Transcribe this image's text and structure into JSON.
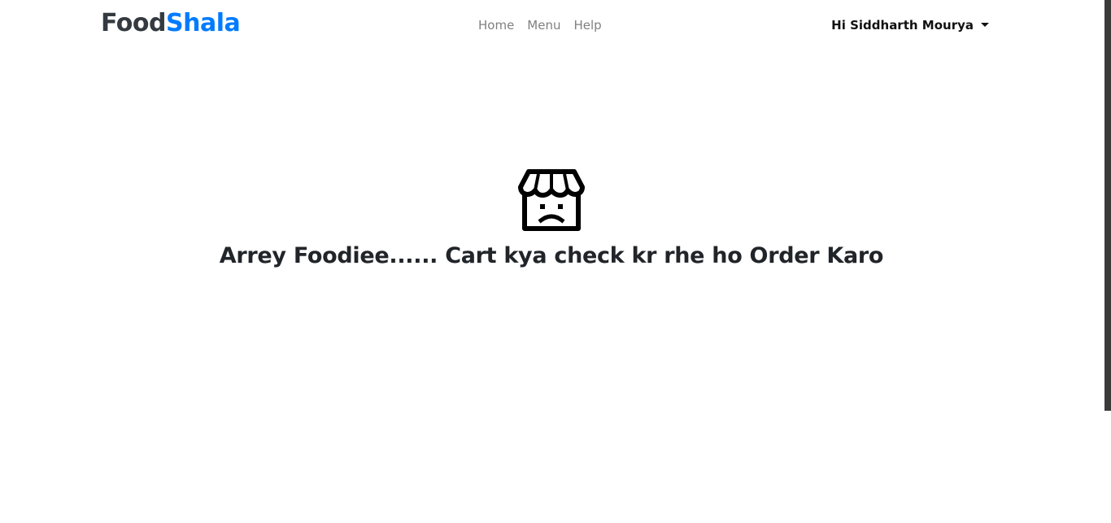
{
  "brand": {
    "part1": "Food",
    "part2": "Shala"
  },
  "nav": {
    "links": [
      {
        "label": "Home"
      },
      {
        "label": "Menu"
      },
      {
        "label": "Help"
      }
    ]
  },
  "user": {
    "greeting": "Hi Siddharth Mourya"
  },
  "empty_cart": {
    "icon": "sad-store-icon",
    "message": "Arrey Foodiee...... Cart kya check kr rhe ho Order Karo"
  },
  "colors": {
    "brand_dark": "#343a40",
    "brand_accent": "#007bff",
    "nav_link": "#808080"
  }
}
